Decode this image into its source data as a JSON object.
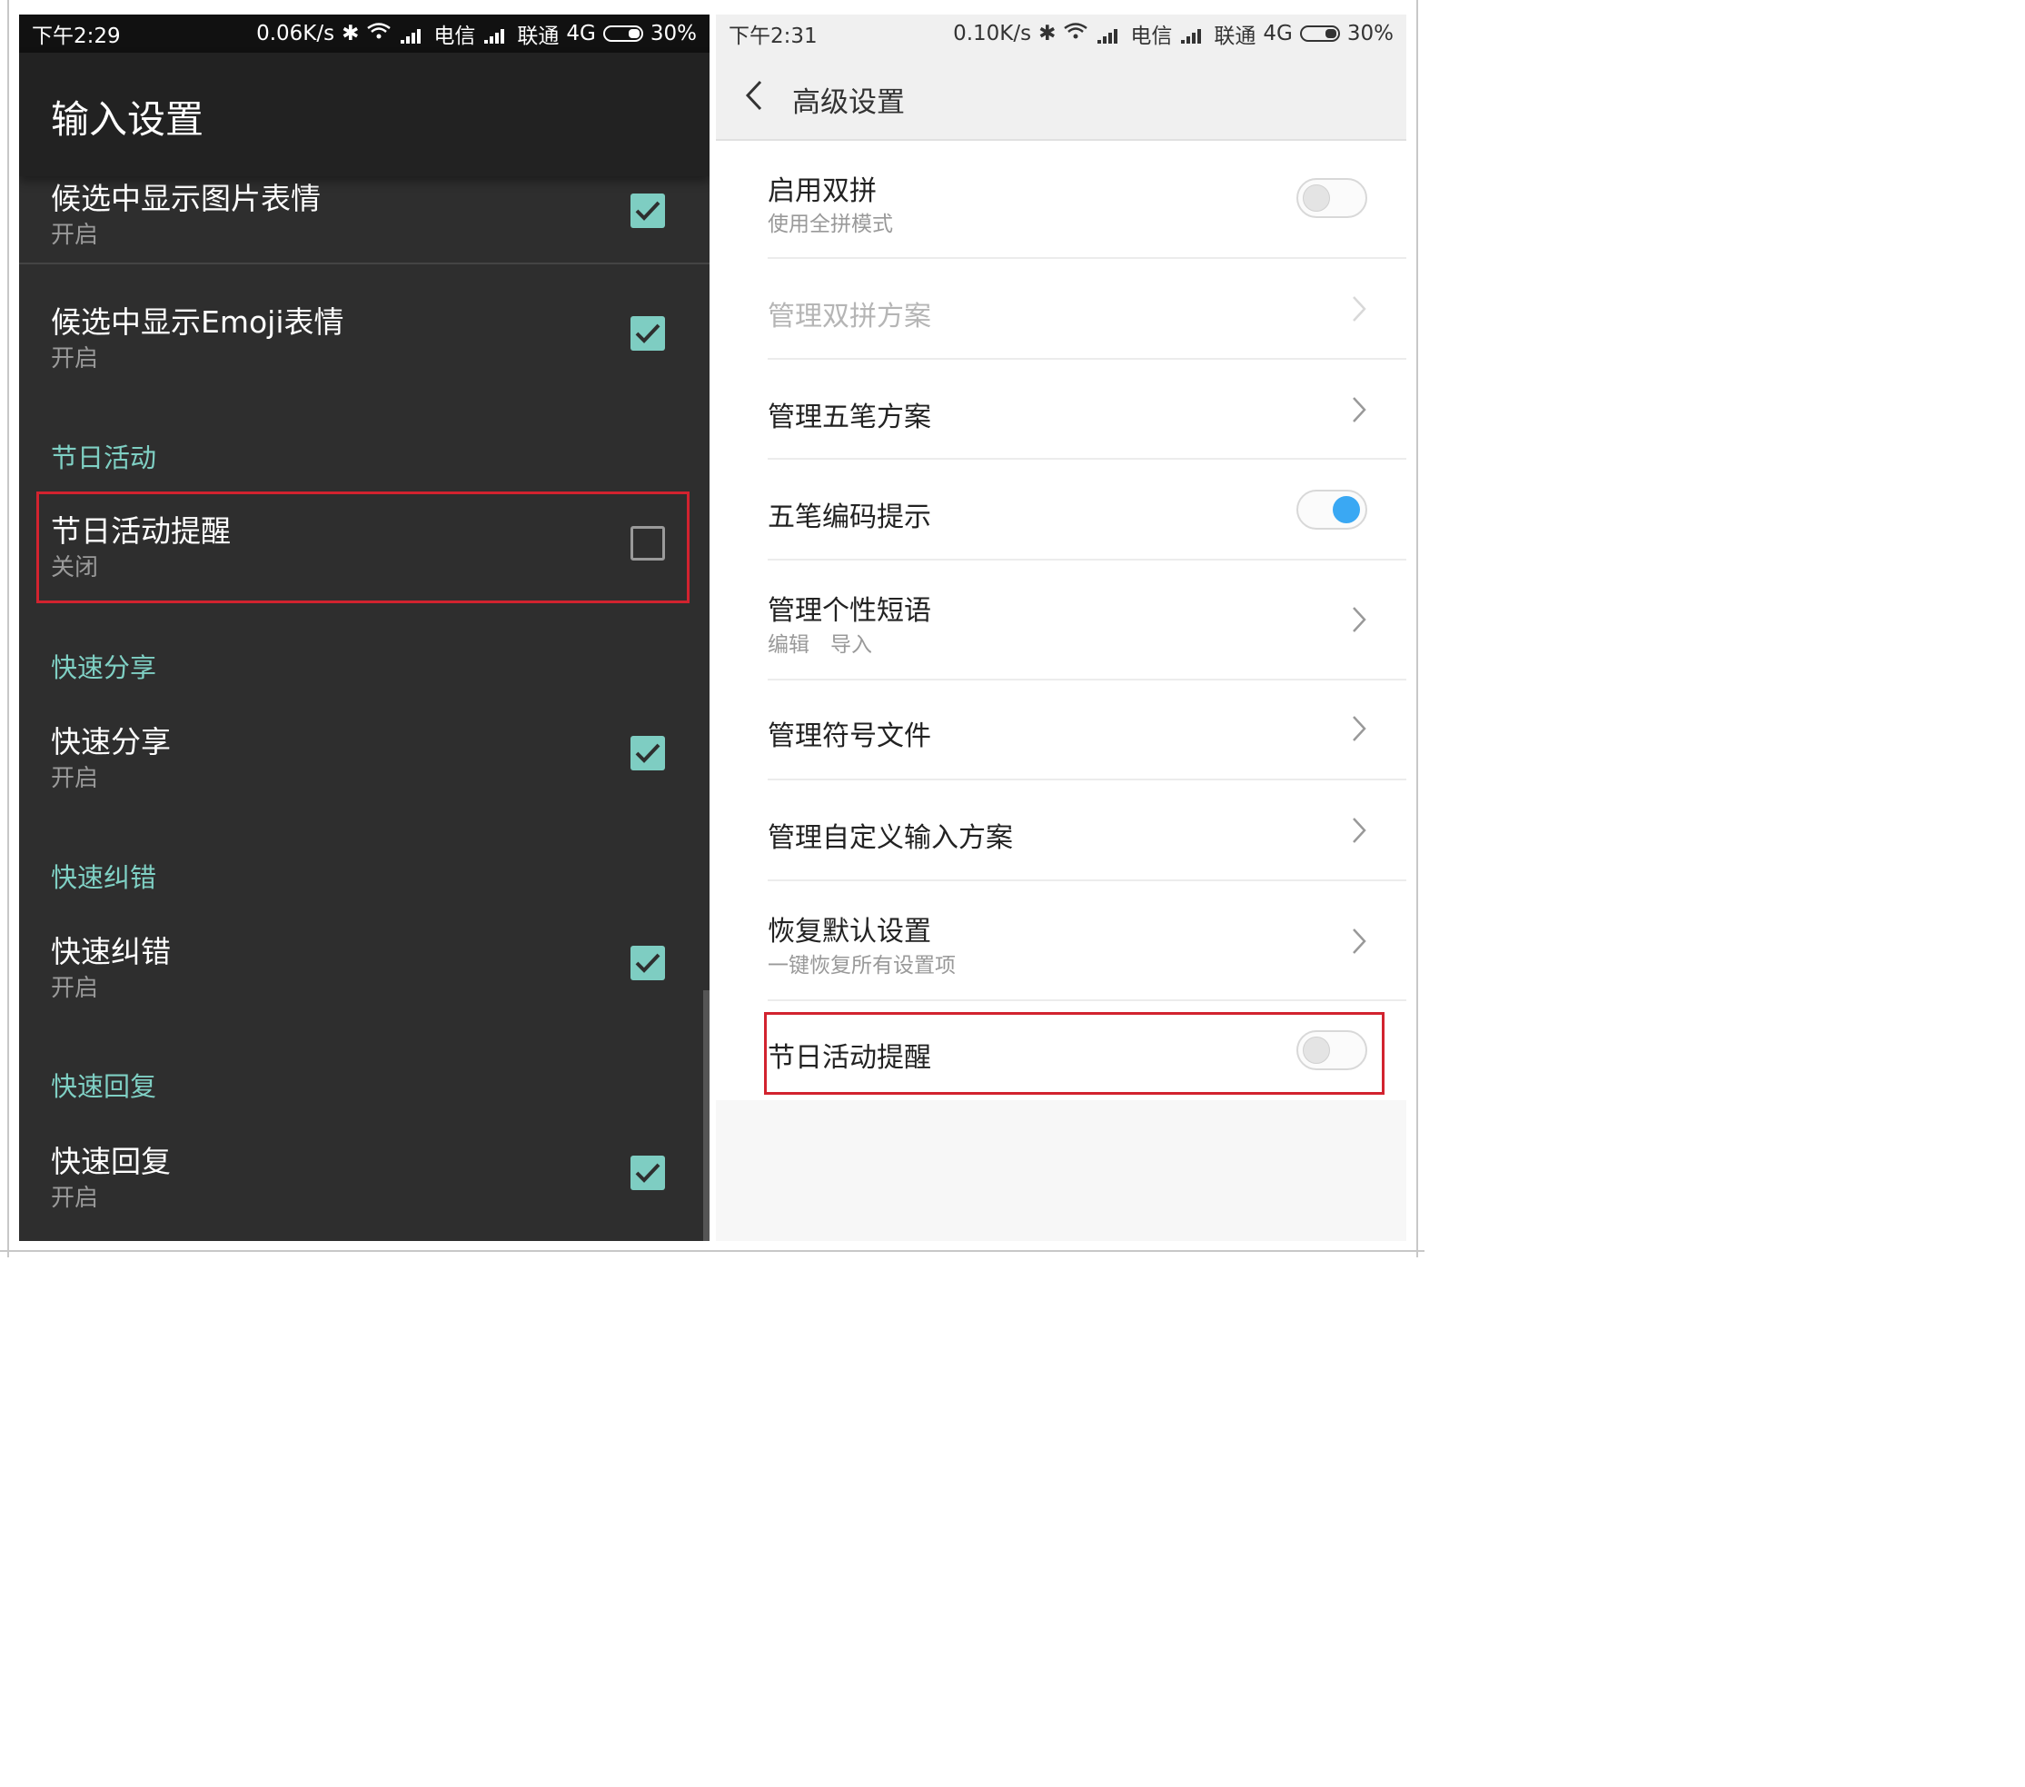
{
  "left": {
    "status": {
      "time": "下午2:29",
      "speed": "0.06K/s",
      "carrier1": "电信",
      "carrier2": "联通",
      "network": "4G",
      "battery": "30%"
    },
    "title": "输入设置",
    "items": [
      {
        "title": "候选中显示图片表情",
        "subtitle": "开启",
        "checked": true
      },
      {
        "title": "候选中显示Emoji表情",
        "subtitle": "开启",
        "checked": true
      },
      {
        "title": "节日活动提醒",
        "subtitle": "关闭",
        "checked": false
      },
      {
        "title": "快速分享",
        "subtitle": "开启",
        "checked": true
      },
      {
        "title": "快速纠错",
        "subtitle": "开启",
        "checked": true
      },
      {
        "title": "快速回复",
        "subtitle": "开启",
        "checked": true
      }
    ],
    "sections": [
      "节日活动",
      "快速分享",
      "快速纠错",
      "快速回复"
    ],
    "accent_color": "#7ecdc2",
    "highlight_color": "#d2232f"
  },
  "right": {
    "status": {
      "time": "下午2:31",
      "speed": "0.10K/s",
      "carrier1": "电信",
      "carrier2": "联通",
      "network": "4G",
      "battery": "30%"
    },
    "title": "高级设置",
    "items": [
      {
        "title": "启用双拼",
        "subtitle": "使用全拼模式",
        "control": "toggle",
        "on": false
      },
      {
        "title": "管理双拼方案",
        "control": "chevron",
        "disabled": true
      },
      {
        "title": "管理五笔方案",
        "control": "chevron"
      },
      {
        "title": "五笔编码提示",
        "control": "toggle",
        "on": true
      },
      {
        "title": "管理个性短语",
        "subtitle": "编辑　导入",
        "control": "chevron"
      },
      {
        "title": "管理符号文件",
        "control": "chevron"
      },
      {
        "title": "管理自定义输入方案",
        "control": "chevron"
      },
      {
        "title": "恢复默认设置",
        "subtitle": "一键恢复所有设置项",
        "control": "chevron"
      },
      {
        "title": "节日活动提醒",
        "control": "toggle",
        "on": false
      }
    ],
    "toggle_on_color": "#3aa8f3"
  }
}
